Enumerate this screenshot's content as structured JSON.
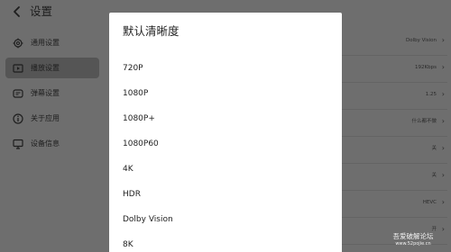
{
  "header": {
    "title": "设置"
  },
  "sidebar": {
    "items": [
      {
        "label": "通用设置",
        "icon": "gear-icon"
      },
      {
        "label": "播放设置",
        "icon": "play-settings-icon",
        "active": true
      },
      {
        "label": "弹幕设置",
        "icon": "danmaku-icon"
      },
      {
        "label": "关于应用",
        "icon": "info-icon"
      },
      {
        "label": "设备信息",
        "icon": "monitor-icon"
      }
    ]
  },
  "settings_values": [
    {
      "value": "Dolby Vision"
    },
    {
      "value": "192Kbps"
    },
    {
      "value": "1.25"
    },
    {
      "value": "什么都不做"
    },
    {
      "value": "关"
    },
    {
      "value": "关"
    },
    {
      "value": "HEVC"
    },
    {
      "value": "开"
    }
  ],
  "dialog": {
    "title": "默认清晰度",
    "options": [
      "720P",
      "1080P",
      "1080P+",
      "1080P60",
      "4K",
      "HDR",
      "Dolby Vision",
      "8K"
    ]
  },
  "watermark": {
    "main": "吾爱破解论坛",
    "sub": "www.52pojie.cn"
  },
  "colors": {
    "overlay": "#6e6e6e",
    "dialog_bg": "#ffffff",
    "active_item": "#555555",
    "text": "#222222"
  }
}
